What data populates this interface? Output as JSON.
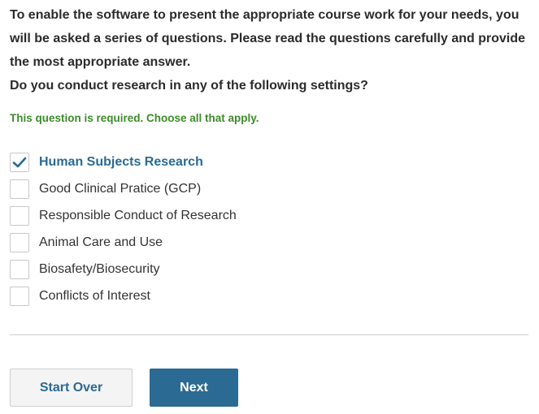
{
  "intro": {
    "paragraph": "To enable the software to present the appropriate course work for your needs, you will be asked a series of questions. Please read the questions carefully and provide the most appropriate answer.",
    "question": "Do you conduct research in any of the following settings?"
  },
  "required_note": "This question is required. Choose all that apply.",
  "options": [
    {
      "label": "Human Subjects Research",
      "checked": true
    },
    {
      "label": "Good Clinical Pratice (GCP)",
      "checked": false
    },
    {
      "label": "Responsible Conduct of Research",
      "checked": false
    },
    {
      "label": "Animal Care and Use",
      "checked": false
    },
    {
      "label": "Biosafety/Biosecurity",
      "checked": false
    },
    {
      "label": "Conflicts of Interest",
      "checked": false
    }
  ],
  "buttons": {
    "start_over": "Start Over",
    "next": "Next"
  },
  "colors": {
    "accent": "#2b6a93",
    "required_green": "#3d8b2a"
  },
  "icons": {
    "checkmark": "checkmark-icon"
  }
}
